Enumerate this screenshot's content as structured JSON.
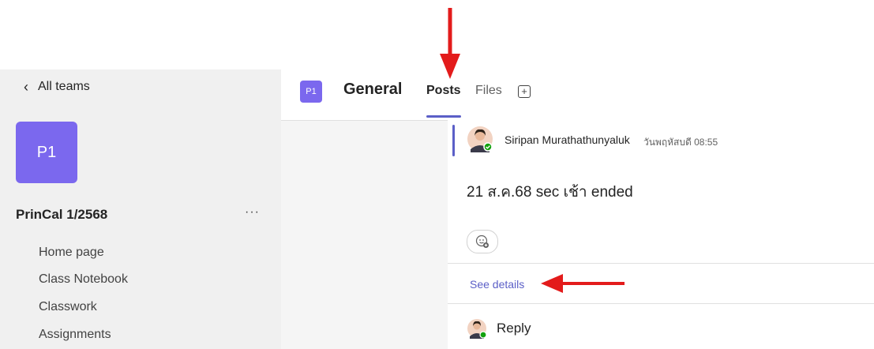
{
  "sidebar": {
    "back_label": "All teams",
    "team_initials": "P1",
    "team_name": "PrinCal 1/2568",
    "more_label": "···",
    "items": [
      {
        "label": "Home page"
      },
      {
        "label": "Class Notebook"
      },
      {
        "label": "Classwork"
      },
      {
        "label": "Assignments"
      }
    ]
  },
  "header": {
    "channel_initials": "P1",
    "channel_name": "General",
    "tabs": [
      {
        "label": "Posts",
        "active": true
      },
      {
        "label": "Files",
        "active": false
      }
    ],
    "add_tab_icon": "plus-icon"
  },
  "post": {
    "author": "Siripan Murathathunyaluk",
    "time": "วันพฤหัสบดี 08:55",
    "body": "21 ส.ค.68 sec เช้า ended",
    "reaction_icon": "emoji-add-icon",
    "details_link": "See details",
    "reply_label": "Reply"
  },
  "colors": {
    "accent": "#5b5fc7",
    "team_avatar": "#7b68ee",
    "annotation_arrow": "#e31b1b"
  }
}
